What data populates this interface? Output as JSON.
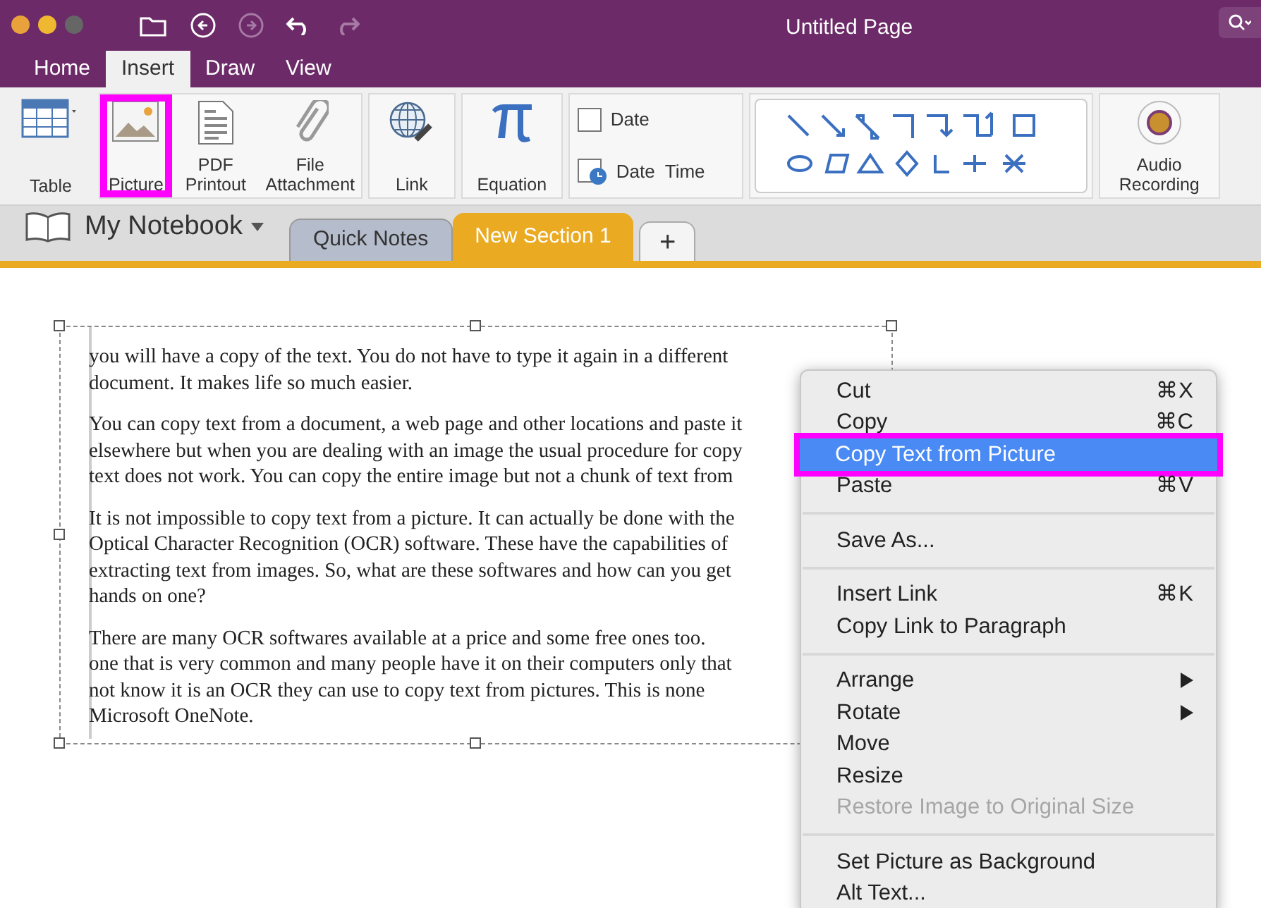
{
  "window": {
    "title": "Untitled Page"
  },
  "ribbon_tabs": [
    {
      "label": "Home",
      "selected": false
    },
    {
      "label": "Insert",
      "selected": true
    },
    {
      "label": "Draw",
      "selected": false
    },
    {
      "label": "View",
      "selected": false
    }
  ],
  "ribbon_buttons": [
    {
      "kind": "table",
      "label": "Table",
      "highlighted": false
    },
    {
      "kind": "picture",
      "label": "Picture",
      "highlighted": true
    },
    {
      "kind": "pdf",
      "label": "PDF Printout",
      "highlighted": false
    },
    {
      "kind": "attachment",
      "label": "File Attachment",
      "highlighted": false
    },
    {
      "kind": "link",
      "label": "Link",
      "highlighted": false
    },
    {
      "kind": "equation",
      "label": "Equation",
      "highlighted": false
    },
    {
      "kind": "datetime",
      "labels": [
        "Date",
        "Date  Time"
      ],
      "highlighted": false
    },
    {
      "kind": "shapes",
      "highlighted": false
    },
    {
      "kind": "audio",
      "label": "Audio Recording",
      "highlighted": false
    }
  ],
  "notebook": {
    "name": "My Notebook",
    "sections": [
      {
        "label": "Quick Notes",
        "selected": false
      },
      {
        "label": "New Section 1",
        "selected": true
      }
    ],
    "add_label": "+"
  },
  "picture_text": [
    [
      "you will have a copy of the text. You do not have to type it again in a different",
      "document. It makes life so much easier."
    ],
    [
      "You can copy text from a document, a web page and other locations and paste it",
      "elsewhere but when you are dealing with an image the usual procedure for copy",
      "text does not work. You can copy the entire image but not a chunk of text from"
    ],
    [
      "It is not impossible to copy text from a picture. It can actually be done with the",
      "Optical Character Recognition (OCR) software. These have the capabilities of",
      "extracting text from images. So, what are these softwares and how can you get",
      "hands on one?"
    ],
    [
      "There are many OCR softwares available at a price and some free ones too.",
      "one that is very common and many people have it on their computers only that",
      "not know it is an OCR they can use to copy text from pictures. This is none",
      "Microsoft OneNote."
    ]
  ],
  "context_menu": [
    [
      {
        "label": "Cut",
        "shortcut": "⌘X",
        "selected": false,
        "disabled": false,
        "highlighted": false
      },
      {
        "label": "Copy",
        "shortcut": "⌘C",
        "selected": false,
        "disabled": false,
        "highlighted": false
      },
      {
        "label": "Copy Text from Picture",
        "selected": true,
        "disabled": false,
        "highlighted": true
      },
      {
        "label": "Paste",
        "shortcut": "⌘V",
        "selected": false,
        "disabled": false,
        "highlighted": false
      }
    ],
    [
      {
        "label": "Save As...",
        "selected": false,
        "disabled": false,
        "highlighted": false
      }
    ],
    [
      {
        "label": "Insert Link",
        "shortcut": "⌘K",
        "selected": false,
        "disabled": false,
        "highlighted": false
      },
      {
        "label": "Copy Link to Paragraph",
        "selected": false,
        "disabled": false,
        "highlighted": false
      }
    ],
    [
      {
        "label": "Arrange",
        "submenu": true,
        "selected": false,
        "disabled": false,
        "highlighted": false
      },
      {
        "label": "Rotate",
        "submenu": true,
        "selected": false,
        "disabled": false,
        "highlighted": false
      },
      {
        "label": "Move",
        "selected": false,
        "disabled": false,
        "highlighted": false
      },
      {
        "label": "Resize",
        "selected": false,
        "disabled": false,
        "highlighted": false
      },
      {
        "label": "Restore Image to Original Size",
        "selected": false,
        "disabled": true,
        "highlighted": false
      }
    ],
    [
      {
        "label": "Set Picture as Background",
        "selected": false,
        "disabled": false,
        "highlighted": false
      },
      {
        "label": "Alt Text...",
        "selected": false,
        "disabled": false,
        "highlighted": false
      }
    ]
  ]
}
